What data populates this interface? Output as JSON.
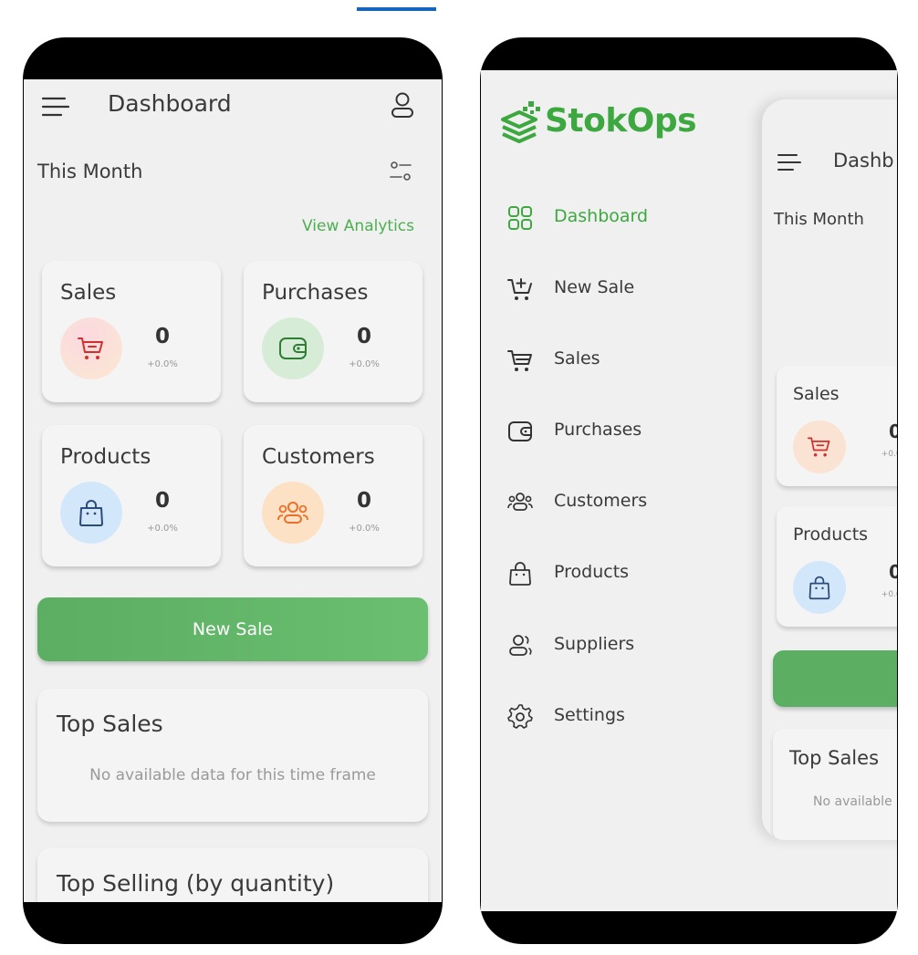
{
  "app": {
    "name": "StokOps"
  },
  "header": {
    "title": "Dashboard"
  },
  "period": {
    "label": "This Month"
  },
  "analytics_link": "View Analytics",
  "stats": [
    {
      "label": "Sales",
      "value": "0",
      "delta": "+0.0%",
      "icon": "shopping-cart-icon",
      "color": "#d32f2f",
      "bg": "#fbe3d3"
    },
    {
      "label": "Purchases",
      "value": "0",
      "delta": "+0.0%",
      "icon": "wallet-icon",
      "color": "#2e7d32",
      "bg": "#d7ecd6"
    },
    {
      "label": "Products",
      "value": "0",
      "delta": "+0.0%",
      "icon": "shopping-bag-icon",
      "color": "#2c4a7a",
      "bg": "#d3e7fb"
    },
    {
      "label": "Customers",
      "value": "0",
      "delta": "+0.0%",
      "icon": "users-icon",
      "color": "#e8702a",
      "bg": "#fde1c4"
    }
  ],
  "actions": {
    "new_sale": "New Sale"
  },
  "sections": {
    "top_sales": {
      "title": "Top Sales",
      "empty": "No available data for this time frame"
    },
    "top_selling": {
      "title": "Top Selling (by quantity)"
    }
  },
  "drawer": {
    "items": [
      {
        "label": "Dashboard",
        "icon": "grid-icon",
        "active": true
      },
      {
        "label": "New Sale",
        "icon": "cart-plus-icon"
      },
      {
        "label": "Sales",
        "icon": "cart-icon"
      },
      {
        "label": "Purchases",
        "icon": "wallet-icon"
      },
      {
        "label": "Customers",
        "icon": "users-icon"
      },
      {
        "label": "Products",
        "icon": "bag-icon"
      },
      {
        "label": "Suppliers",
        "icon": "supplier-icon"
      },
      {
        "label": "Settings",
        "icon": "gear-icon"
      }
    ]
  },
  "peek": {
    "title": "Dashb",
    "empty": "No available"
  },
  "colors": {
    "accent": "#4caf50",
    "button": "#66b86a",
    "tab_indicator": "#1565c0"
  }
}
